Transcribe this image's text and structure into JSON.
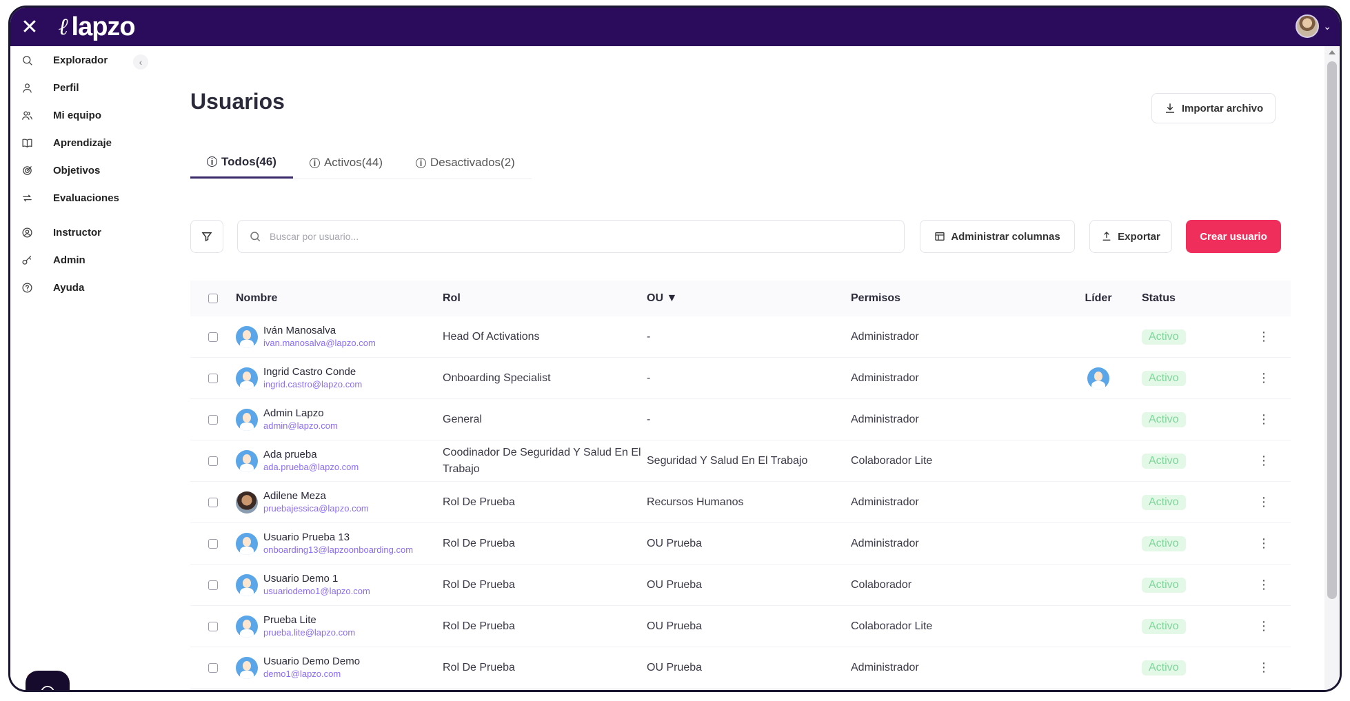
{
  "app": {
    "brand": "lapzo",
    "logo_mark": "ℓ"
  },
  "sidebar": {
    "items": [
      {
        "id": "explorador",
        "label": "Explorador",
        "icon": "search-icon"
      },
      {
        "id": "perfil",
        "label": "Perfil",
        "icon": "user-icon"
      },
      {
        "id": "mi-equipo",
        "label": "Mi equipo",
        "icon": "team-icon"
      },
      {
        "id": "aprendizaje",
        "label": "Aprendizaje",
        "icon": "book-icon"
      },
      {
        "id": "objetivos",
        "label": "Objetivos",
        "icon": "target-icon"
      },
      {
        "id": "evaluaciones",
        "label": "Evaluaciones",
        "icon": "exchange-icon"
      },
      {
        "id": "instructor",
        "label": "Instructor",
        "icon": "instructor-icon"
      },
      {
        "id": "admin",
        "label": "Admin",
        "icon": "key-icon"
      },
      {
        "id": "ayuda",
        "label": "Ayuda",
        "icon": "help-icon"
      }
    ]
  },
  "header": {
    "title": "Usuarios",
    "import_label": "Importar archivo"
  },
  "tabs": [
    {
      "label": "Todos(46)",
      "active": true
    },
    {
      "label": "Activos(44)",
      "active": false
    },
    {
      "label": "Desactivados(2)",
      "active": false
    }
  ],
  "toolbar": {
    "search_placeholder": "Buscar por usuario...",
    "columns_label": "Administrar columnas",
    "export_label": "Exportar",
    "create_label": "Crear usuario"
  },
  "table": {
    "headers": {
      "name": "Nombre",
      "rol": "Rol",
      "ou": "OU ▼",
      "perm": "Permisos",
      "lider": "Líder",
      "status": "Status"
    },
    "rows": [
      {
        "name": "Iván Manosalva",
        "email": "ivan.manosalva@lapzo.com",
        "rol": "Head Of Activations",
        "ou": "-",
        "perm": "Administrador",
        "lider": false,
        "status": "Activo",
        "photo": false
      },
      {
        "name": "Ingrid Castro Conde",
        "email": "ingrid.castro@lapzo.com",
        "rol": "Onboarding Specialist",
        "ou": "-",
        "perm": "Administrador",
        "lider": true,
        "status": "Activo",
        "photo": false
      },
      {
        "name": "Admin Lapzo",
        "email": "admin@lapzo.com",
        "rol": "General",
        "ou": "-",
        "perm": "Administrador",
        "lider": false,
        "status": "Activo",
        "photo": false
      },
      {
        "name": "Ada prueba",
        "email": "ada.prueba@lapzo.com",
        "rol": "Coodinador De Seguridad Y Salud En El Trabajo",
        "ou": "Seguridad Y Salud En El Trabajo",
        "perm": "Colaborador Lite",
        "lider": false,
        "status": "Activo",
        "photo": false
      },
      {
        "name": "Adilene Meza",
        "email": "pruebajessica@lapzo.com",
        "rol": "Rol De Prueba",
        "ou": "Recursos Humanos",
        "perm": "Administrador",
        "lider": false,
        "status": "Activo",
        "photo": true
      },
      {
        "name": "Usuario Prueba 13",
        "email": "onboarding13@lapzoonboarding.com",
        "rol": "Rol De Prueba",
        "ou": "OU Prueba",
        "perm": "Administrador",
        "lider": false,
        "status": "Activo",
        "photo": false
      },
      {
        "name": "Usuario Demo 1",
        "email": "usuariodemo1@lapzo.com",
        "rol": "Rol De Prueba",
        "ou": "OU Prueba",
        "perm": "Colaborador",
        "lider": false,
        "status": "Activo",
        "photo": false
      },
      {
        "name": "Prueba Lite",
        "email": "prueba.lite@lapzo.com",
        "rol": "Rol De Prueba",
        "ou": "OU Prueba",
        "perm": "Colaborador Lite",
        "lider": false,
        "status": "Activo",
        "photo": false
      },
      {
        "name": "Usuario Demo Demo",
        "email": "demo1@lapzo.com",
        "rol": "Rol De Prueba",
        "ou": "OU Prueba",
        "perm": "Administrador",
        "lider": false,
        "status": "Activo",
        "photo": false
      }
    ]
  },
  "colors": {
    "topbar": "#2b0b5c",
    "accent": "#ef2e5b",
    "email": "#8b6cf3",
    "status_bg": "#e3f8e6",
    "status_text": "#7ed69a"
  }
}
